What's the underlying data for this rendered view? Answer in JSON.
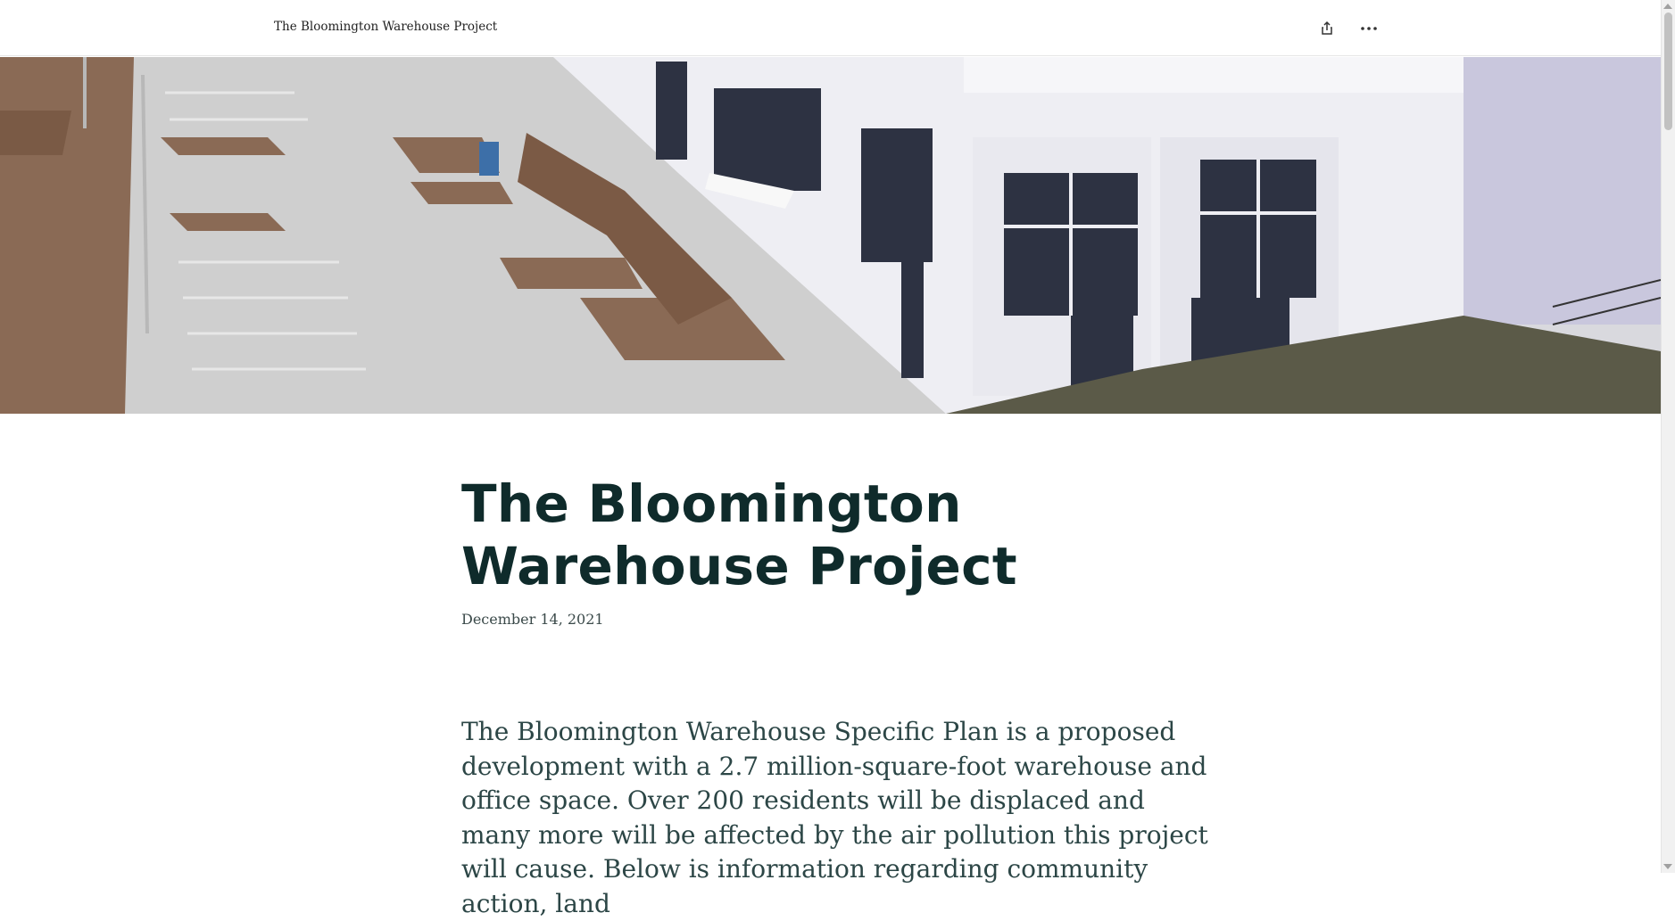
{
  "header": {
    "site_title": "The Bloomington Warehouse Project",
    "share_icon": "share-icon",
    "more_icon": "more-horizontal-icon"
  },
  "hero": {
    "alt": "Aerial view of a white warehouse building with parking lot and landscaping"
  },
  "article": {
    "title": "The Bloomington Warehouse Project",
    "date": "December 14, 2021",
    "intro": "The Bloomington Warehouse Specific Plan is a proposed development with a 2.7 million-square-foot warehouse and office space. Over 200 residents will be displaced and many more will be affected by the air pollution this project will cause. Below is information regarding community action, land"
  },
  "colors": {
    "title": "#0f2b2b",
    "body": "#2c4646",
    "background": "#ffffff"
  }
}
